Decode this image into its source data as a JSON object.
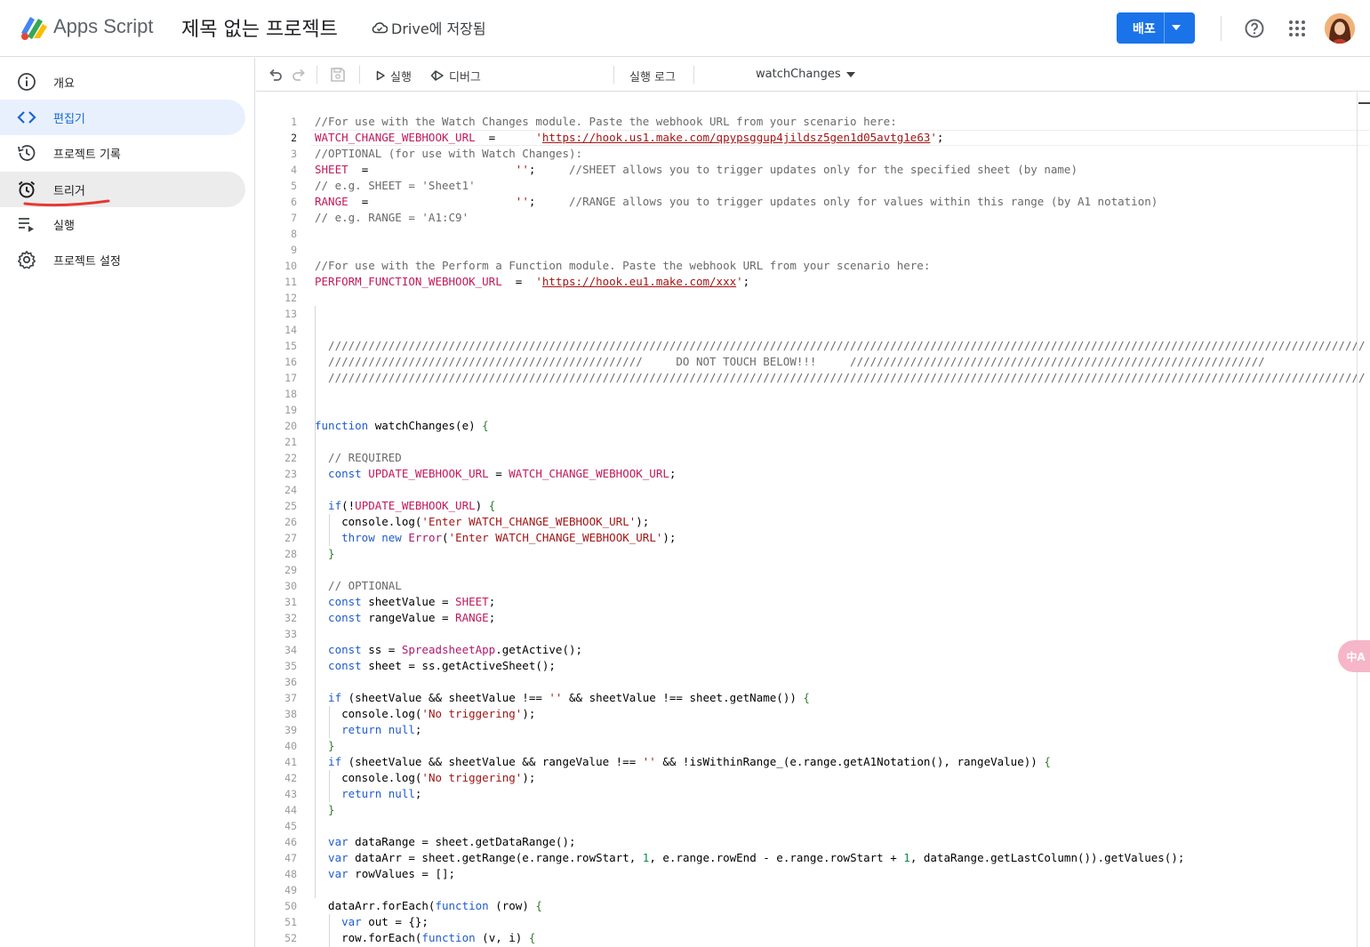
{
  "header": {
    "app_name": "Apps Script",
    "project_title": "제목 없는 프로젝트",
    "save_status": "Drive에 저장됨",
    "deploy_label": "배포",
    "colors": {
      "accent": "#1a73e8",
      "active_nav_bg": "#e8f0fe",
      "active_nav_text": "#1967d2",
      "annotation": "#e53935"
    }
  },
  "sidebar": {
    "items": [
      {
        "label": "개요",
        "icon": "info-icon"
      },
      {
        "label": "편집기",
        "icon": "code-icon",
        "active": true
      },
      {
        "label": "프로젝트 기록",
        "icon": "history-icon"
      },
      {
        "label": "트리거",
        "icon": "alarm-clock-icon",
        "hovered": true
      },
      {
        "label": "실행",
        "icon": "executions-icon"
      },
      {
        "label": "프로젝트 설정",
        "icon": "gear-icon"
      }
    ]
  },
  "toolbar": {
    "run_label": "실행",
    "debug_label": "디버그",
    "function_selected": "watchChanges",
    "log_label": "실행 로그"
  },
  "editor": {
    "current_line": 2,
    "line_numbers": [
      "1",
      "2",
      "3",
      "4",
      "5",
      "6",
      "7",
      "8",
      "9",
      "10",
      "11",
      "12",
      "13",
      "14",
      "15",
      "16",
      "17",
      "18",
      "19",
      "20",
      "21",
      "22",
      "23",
      "24",
      "25",
      "26",
      "27",
      "28",
      "29",
      "30",
      "31",
      "32",
      "33",
      "34",
      "35",
      "36",
      "37",
      "38",
      "39",
      "40",
      "41",
      "42",
      "43",
      "44",
      "45",
      "46",
      "47",
      "48",
      "49",
      "50",
      "51",
      "52"
    ],
    "lines": [
      [
        [
          "c-com",
          "//For use with the Watch Changes module. Paste the webhook URL from your scenario here:"
        ]
      ],
      [
        [
          "c-var",
          "WATCH_CHANGE_WEBHOOK_URL"
        ],
        [
          "",
          "  =      "
        ],
        [
          "c-str",
          "'"
        ],
        [
          "c-url",
          "https://hook.us1.make.com/qpypsggup4jildsz5gen1d05avtg1e63"
        ],
        [
          "c-str",
          "'"
        ],
        [
          "",
          ";"
        ]
      ],
      [
        [
          "c-com",
          "//OPTIONAL (for use with Watch Changes):"
        ]
      ],
      [
        [
          "c-var",
          "SHEET"
        ],
        [
          "",
          "  =                      "
        ],
        [
          "c-str",
          "''"
        ],
        [
          "",
          ";     "
        ],
        [
          "c-com",
          "//SHEET allows you to trigger updates only for the specified sheet (by name)"
        ]
      ],
      [
        [
          "c-com",
          "// e.g. SHEET = 'Sheet1'"
        ]
      ],
      [
        [
          "c-var",
          "RANGE"
        ],
        [
          "",
          "  =                      "
        ],
        [
          "c-str",
          "''"
        ],
        [
          "",
          ";     "
        ],
        [
          "c-com",
          "//RANGE allows you to trigger updates only for values within this range (by A1 notation)"
        ]
      ],
      [
        [
          "c-com",
          "// e.g. RANGE = 'A1:C9'"
        ]
      ],
      [],
      [],
      [
        [
          "c-com",
          "//For use with the Perform a Function module. Paste the webhook URL from your scenario here:"
        ]
      ],
      [
        [
          "c-var",
          "PERFORM_FUNCTION_WEBHOOK_URL"
        ],
        [
          "",
          "  =  "
        ],
        [
          "c-str",
          "'"
        ],
        [
          "c-url",
          "https://hook.eu1.make.com/xxx"
        ],
        [
          "c-str",
          "'"
        ],
        [
          "",
          ";"
        ]
      ],
      [],
      [],
      [],
      [
        [
          "c-com",
          "  ///////////////////////////////////////////////////////////////////////////////////////////////////////////////////////////////////////////////////////////"
        ]
      ],
      [
        [
          "c-com",
          "  ///////////////////////////////////////////////     DO NOT TOUCH BELOW!!!     //////////////////////////////////////////////////////////////"
        ]
      ],
      [
        [
          "c-com",
          "  ///////////////////////////////////////////////////////////////////////////////////////////////////////////////////////////////////////////////////////////"
        ]
      ],
      [],
      [],
      [
        [
          "c-kw",
          "function"
        ],
        [
          "",
          " watchChanges(e) "
        ],
        [
          "c-br",
          "{"
        ]
      ],
      [],
      [
        [
          "c-com",
          "  // REQUIRED"
        ]
      ],
      [
        [
          "c-kw",
          "  const"
        ],
        [
          "",
          " "
        ],
        [
          "c-var",
          "UPDATE_WEBHOOK_URL"
        ],
        [
          "",
          " = "
        ],
        [
          "c-var",
          "WATCH_CHANGE_WEBHOOK_URL"
        ],
        [
          "",
          ";"
        ]
      ],
      [],
      [
        [
          "c-kw",
          "  if"
        ],
        [
          "",
          "(!"
        ],
        [
          "c-var",
          "UPDATE_WEBHOOK_URL"
        ],
        [
          "",
          ") "
        ],
        [
          "c-br",
          "{"
        ]
      ],
      [
        [
          "",
          "    console.log("
        ],
        [
          "c-str",
          "'Enter WATCH_CHANGE_WEBHOOK_URL'"
        ],
        [
          "",
          ");"
        ]
      ],
      [
        [
          "c-kw",
          "    throw new"
        ],
        [
          "",
          " "
        ],
        [
          "c-cls",
          "Error"
        ],
        [
          "",
          "("
        ],
        [
          "c-str",
          "'Enter WATCH_CHANGE_WEBHOOK_URL'"
        ],
        [
          "",
          ");"
        ]
      ],
      [
        [
          "c-br",
          "  }"
        ]
      ],
      [],
      [
        [
          "c-com",
          "  // OPTIONAL"
        ]
      ],
      [
        [
          "c-kw",
          "  const"
        ],
        [
          "",
          " sheetValue = "
        ],
        [
          "c-var",
          "SHEET"
        ],
        [
          "",
          ";"
        ]
      ],
      [
        [
          "c-kw",
          "  const"
        ],
        [
          "",
          " rangeValue = "
        ],
        [
          "c-var",
          "RANGE"
        ],
        [
          "",
          ";"
        ]
      ],
      [],
      [
        [
          "c-kw",
          "  const"
        ],
        [
          "",
          " ss = "
        ],
        [
          "c-cls",
          "SpreadsheetApp"
        ],
        [
          "",
          ".getActive();"
        ]
      ],
      [
        [
          "c-kw",
          "  const"
        ],
        [
          "",
          " sheet = ss.getActiveSheet();"
        ]
      ],
      [],
      [
        [
          "c-kw",
          "  if"
        ],
        [
          "",
          " (sheetValue && sheetValue !== "
        ],
        [
          "c-str",
          "''"
        ],
        [
          "",
          " && sheetValue !== sheet.getName()) "
        ],
        [
          "c-br",
          "{"
        ]
      ],
      [
        [
          "",
          "    console.log("
        ],
        [
          "c-str",
          "'No triggering'"
        ],
        [
          "",
          ");"
        ]
      ],
      [
        [
          "c-kw",
          "    return null"
        ],
        [
          "",
          ";"
        ]
      ],
      [
        [
          "c-br",
          "  }"
        ]
      ],
      [
        [
          "c-kw",
          "  if"
        ],
        [
          "",
          " (sheetValue && sheetValue && rangeValue !== "
        ],
        [
          "c-str",
          "''"
        ],
        [
          "",
          " && !isWithinRange_(e.range.getA1Notation(), rangeValue)) "
        ],
        [
          "c-br",
          "{"
        ]
      ],
      [
        [
          "",
          "    console.log("
        ],
        [
          "c-str",
          "'No triggering'"
        ],
        [
          "",
          ");"
        ]
      ],
      [
        [
          "c-kw",
          "    return null"
        ],
        [
          "",
          ";"
        ]
      ],
      [
        [
          "c-br",
          "  }"
        ]
      ],
      [],
      [
        [
          "c-kw",
          "  var"
        ],
        [
          "",
          " dataRange = sheet.getDataRange();"
        ]
      ],
      [
        [
          "c-kw",
          "  var"
        ],
        [
          "",
          " dataArr = sheet.getRange(e.range.rowStart, "
        ],
        [
          "c-num",
          "1"
        ],
        [
          "",
          ", e.range.rowEnd - e.range.rowStart + "
        ],
        [
          "c-num",
          "1"
        ],
        [
          "",
          ", dataRange.getLastColumn()).getValues();"
        ]
      ],
      [
        [
          "c-kw",
          "  var"
        ],
        [
          "",
          " rowValues = [];"
        ]
      ],
      [],
      [
        [
          "",
          "  dataArr.forEach("
        ],
        [
          "c-kw",
          "function"
        ],
        [
          "",
          " (row) "
        ],
        [
          "c-br",
          "{"
        ]
      ],
      [
        [
          "c-kw",
          "    var"
        ],
        [
          "",
          " out = {};"
        ]
      ],
      [
        [
          "",
          "    row.forEach("
        ],
        [
          "c-kw",
          "function"
        ],
        [
          "",
          " (v, i) "
        ],
        [
          "c-br",
          "{"
        ]
      ]
    ]
  },
  "translate_fab": "中A"
}
